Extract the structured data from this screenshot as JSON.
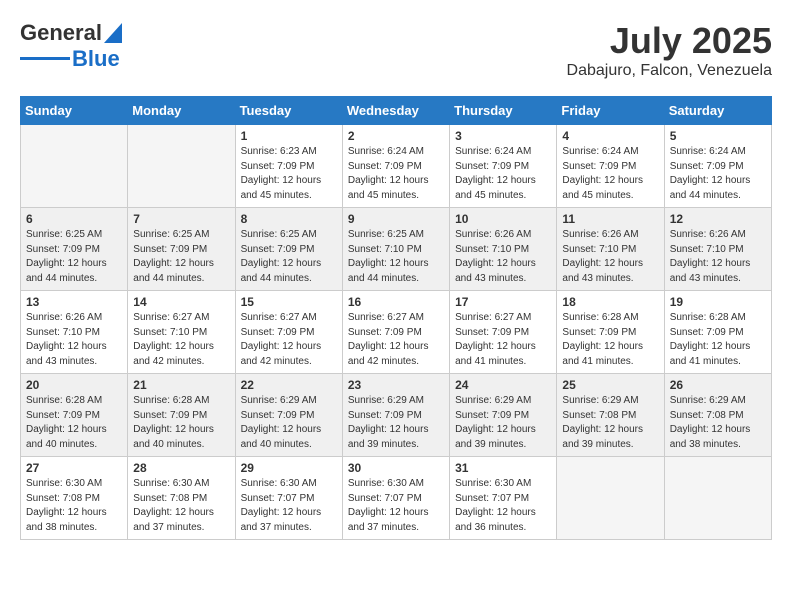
{
  "header": {
    "logo_general": "General",
    "logo_blue": "Blue",
    "month_year": "July 2025",
    "location": "Dabajuro, Falcon, Venezuela"
  },
  "weekdays": [
    "Sunday",
    "Monday",
    "Tuesday",
    "Wednesday",
    "Thursday",
    "Friday",
    "Saturday"
  ],
  "weeks": [
    [
      {
        "day": "",
        "empty": true
      },
      {
        "day": "",
        "empty": true
      },
      {
        "day": "1",
        "sunrise": "6:23 AM",
        "sunset": "7:09 PM",
        "daylight": "12 hours and 45 minutes."
      },
      {
        "day": "2",
        "sunrise": "6:24 AM",
        "sunset": "7:09 PM",
        "daylight": "12 hours and 45 minutes."
      },
      {
        "day": "3",
        "sunrise": "6:24 AM",
        "sunset": "7:09 PM",
        "daylight": "12 hours and 45 minutes."
      },
      {
        "day": "4",
        "sunrise": "6:24 AM",
        "sunset": "7:09 PM",
        "daylight": "12 hours and 45 minutes."
      },
      {
        "day": "5",
        "sunrise": "6:24 AM",
        "sunset": "7:09 PM",
        "daylight": "12 hours and 44 minutes."
      }
    ],
    [
      {
        "day": "6",
        "sunrise": "6:25 AM",
        "sunset": "7:09 PM",
        "daylight": "12 hours and 44 minutes."
      },
      {
        "day": "7",
        "sunrise": "6:25 AM",
        "sunset": "7:09 PM",
        "daylight": "12 hours and 44 minutes."
      },
      {
        "day": "8",
        "sunrise": "6:25 AM",
        "sunset": "7:09 PM",
        "daylight": "12 hours and 44 minutes."
      },
      {
        "day": "9",
        "sunrise": "6:25 AM",
        "sunset": "7:10 PM",
        "daylight": "12 hours and 44 minutes."
      },
      {
        "day": "10",
        "sunrise": "6:26 AM",
        "sunset": "7:10 PM",
        "daylight": "12 hours and 43 minutes."
      },
      {
        "day": "11",
        "sunrise": "6:26 AM",
        "sunset": "7:10 PM",
        "daylight": "12 hours and 43 minutes."
      },
      {
        "day": "12",
        "sunrise": "6:26 AM",
        "sunset": "7:10 PM",
        "daylight": "12 hours and 43 minutes."
      }
    ],
    [
      {
        "day": "13",
        "sunrise": "6:26 AM",
        "sunset": "7:10 PM",
        "daylight": "12 hours and 43 minutes."
      },
      {
        "day": "14",
        "sunrise": "6:27 AM",
        "sunset": "7:10 PM",
        "daylight": "12 hours and 42 minutes."
      },
      {
        "day": "15",
        "sunrise": "6:27 AM",
        "sunset": "7:09 PM",
        "daylight": "12 hours and 42 minutes."
      },
      {
        "day": "16",
        "sunrise": "6:27 AM",
        "sunset": "7:09 PM",
        "daylight": "12 hours and 42 minutes."
      },
      {
        "day": "17",
        "sunrise": "6:27 AM",
        "sunset": "7:09 PM",
        "daylight": "12 hours and 41 minutes."
      },
      {
        "day": "18",
        "sunrise": "6:28 AM",
        "sunset": "7:09 PM",
        "daylight": "12 hours and 41 minutes."
      },
      {
        "day": "19",
        "sunrise": "6:28 AM",
        "sunset": "7:09 PM",
        "daylight": "12 hours and 41 minutes."
      }
    ],
    [
      {
        "day": "20",
        "sunrise": "6:28 AM",
        "sunset": "7:09 PM",
        "daylight": "12 hours and 40 minutes."
      },
      {
        "day": "21",
        "sunrise": "6:28 AM",
        "sunset": "7:09 PM",
        "daylight": "12 hours and 40 minutes."
      },
      {
        "day": "22",
        "sunrise": "6:29 AM",
        "sunset": "7:09 PM",
        "daylight": "12 hours and 40 minutes."
      },
      {
        "day": "23",
        "sunrise": "6:29 AM",
        "sunset": "7:09 PM",
        "daylight": "12 hours and 39 minutes."
      },
      {
        "day": "24",
        "sunrise": "6:29 AM",
        "sunset": "7:09 PM",
        "daylight": "12 hours and 39 minutes."
      },
      {
        "day": "25",
        "sunrise": "6:29 AM",
        "sunset": "7:08 PM",
        "daylight": "12 hours and 39 minutes."
      },
      {
        "day": "26",
        "sunrise": "6:29 AM",
        "sunset": "7:08 PM",
        "daylight": "12 hours and 38 minutes."
      }
    ],
    [
      {
        "day": "27",
        "sunrise": "6:30 AM",
        "sunset": "7:08 PM",
        "daylight": "12 hours and 38 minutes."
      },
      {
        "day": "28",
        "sunrise": "6:30 AM",
        "sunset": "7:08 PM",
        "daylight": "12 hours and 37 minutes."
      },
      {
        "day": "29",
        "sunrise": "6:30 AM",
        "sunset": "7:07 PM",
        "daylight": "12 hours and 37 minutes."
      },
      {
        "day": "30",
        "sunrise": "6:30 AM",
        "sunset": "7:07 PM",
        "daylight": "12 hours and 37 minutes."
      },
      {
        "day": "31",
        "sunrise": "6:30 AM",
        "sunset": "7:07 PM",
        "daylight": "12 hours and 36 minutes."
      },
      {
        "day": "",
        "empty": true
      },
      {
        "day": "",
        "empty": true
      }
    ]
  ]
}
